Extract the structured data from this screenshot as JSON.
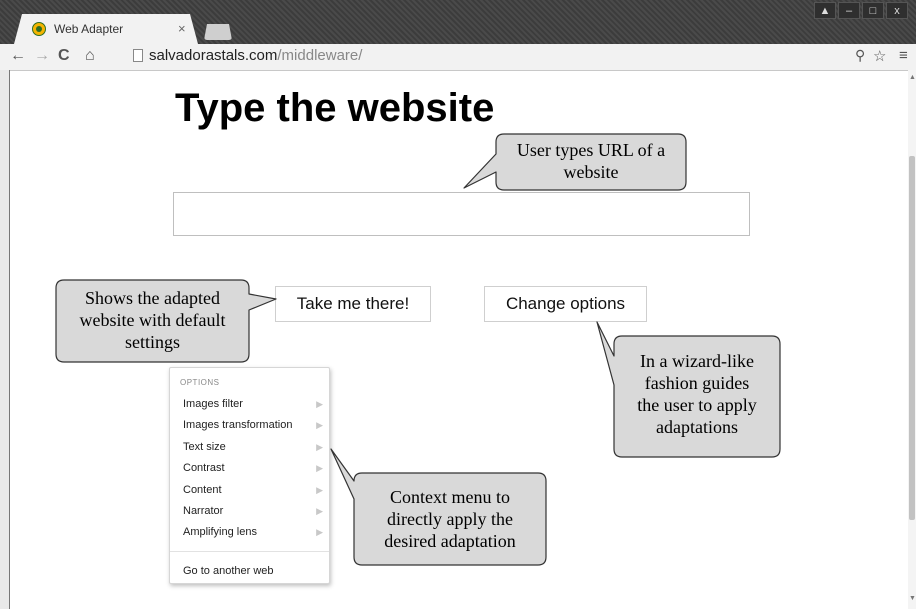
{
  "browser": {
    "tab_title": "Web Adapter",
    "tab_close": "×",
    "url_host": "salvadorastals.com",
    "url_path": "/middleware/"
  },
  "page": {
    "title": "Type the website",
    "url_input_value": "",
    "take_me_there_label": "Take me there!",
    "change_options_label": "Change options"
  },
  "context_menu": {
    "header": "OPTIONS",
    "items": [
      {
        "label": "Images filter"
      },
      {
        "label": "Images transformation"
      },
      {
        "label": "Text size"
      },
      {
        "label": "Contrast"
      },
      {
        "label": "Content"
      },
      {
        "label": "Narrator"
      },
      {
        "label": "Amplifying lens"
      }
    ],
    "footer_item": "Go to another web"
  },
  "callouts": {
    "url_hint_line1": "User types URL of a",
    "url_hint_line2": "website",
    "default_line1": "Shows the adapted",
    "default_line2": "website with default",
    "default_line3": "settings",
    "wizard_line1": "In a wizard-like",
    "wizard_line2": "fashion guides",
    "wizard_line3": "the user to apply",
    "wizard_line4": "adaptations",
    "context_line1": "Context menu to",
    "context_line2": "directly apply the",
    "context_line3": "desired adaptation"
  },
  "colors": {
    "callout_fill": "#d9d9d9",
    "callout_stroke": "#333333",
    "favicon": "#f5b400"
  }
}
